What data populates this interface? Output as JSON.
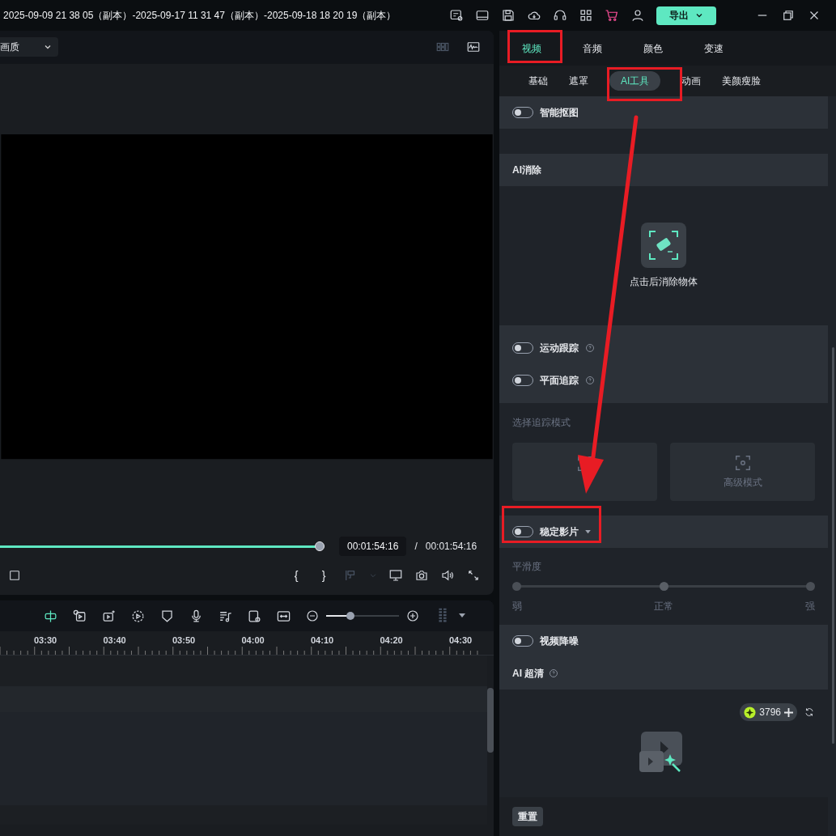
{
  "title_bar": {
    "title": "2025-09-09 21 38 05（副本）-2025-09-17 11 31 47（副本）-2025-09-18 18 20 19（副本）",
    "export_button": "导出"
  },
  "preview": {
    "quality_dropdown": "画质",
    "progress": {
      "level": 1
    },
    "current_time": "00:01:54:16",
    "separator": "/",
    "total_time": "00:01:54:16",
    "mark_in": "{",
    "mark_out": "}"
  },
  "timeline": {
    "zoom": {
      "level": 0.33
    },
    "ruler": [
      "03:30",
      "03:40",
      "03:50",
      "04:00",
      "04:10",
      "04:20",
      "04:30"
    ]
  },
  "right_panel": {
    "tabs": [
      {
        "label": "视频",
        "selected": true
      },
      {
        "label": "音频",
        "selected": false
      },
      {
        "label": "颜色",
        "selected": false
      },
      {
        "label": "变速",
        "selected": false
      }
    ],
    "subtabs": [
      {
        "label": "基础",
        "selected": false
      },
      {
        "label": "遮罩",
        "selected": false
      },
      {
        "label": "AI工具",
        "selected": true
      },
      {
        "label": "动画",
        "selected": false
      },
      {
        "label": "美颜瘦脸",
        "selected": false
      }
    ],
    "smart_cutout": {
      "label": "智能抠图",
      "on": false
    },
    "ai_remove": {
      "title": "AI消除",
      "action": "点击后消除物体"
    },
    "tracking": [
      {
        "label": "运动跟踪",
        "on": false
      },
      {
        "label": "平面追踪",
        "on": false
      }
    ],
    "track_mode": {
      "label": "选择追踪模式",
      "options": [
        {
          "kind": "basic"
        },
        {
          "kind": "advanced",
          "label": "高级模式"
        }
      ]
    },
    "stabilize": {
      "label": "稳定影片",
      "on": false,
      "smoothness": {
        "label": "平滑度",
        "level": 0.5,
        "low": "弱",
        "mid": "正常",
        "high": "强"
      }
    },
    "video_denoise": {
      "label": "视频降噪",
      "on": false
    },
    "ai_hd": {
      "title": "AI 超清",
      "credits": "3796"
    },
    "reset_button": "重置"
  }
}
